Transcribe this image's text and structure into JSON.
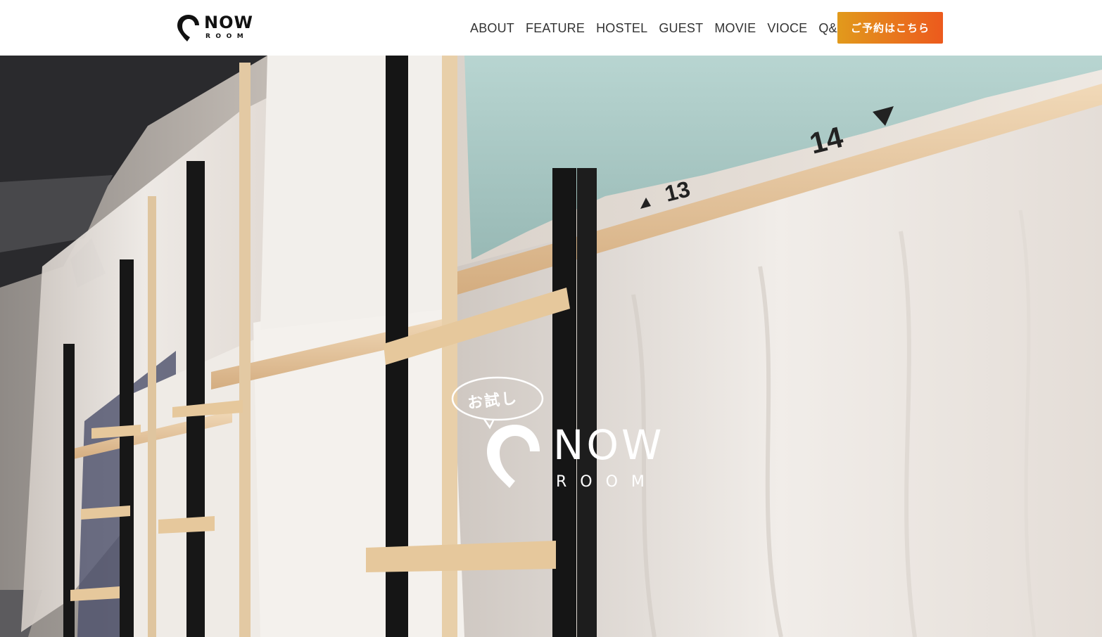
{
  "header": {
    "logo": {
      "word": "NOW",
      "sub": "ROOM"
    },
    "nav": [
      {
        "label": "ABOUT"
      },
      {
        "label": "FEATURE"
      },
      {
        "label": "HOSTEL"
      },
      {
        "label": "GUEST"
      },
      {
        "label": "MOVIE"
      },
      {
        "label": "VIOCE"
      },
      {
        "label": "Q&A"
      }
    ],
    "cta_label": "ご予約はこちら"
  },
  "hero": {
    "badge": "お試し",
    "logo_word": "NOW",
    "logo_sub": "ROOM",
    "bunk_numbers": [
      "13",
      "14"
    ]
  },
  "colors": {
    "cta_start": "#e19a1c",
    "cta_end": "#ec5a1d",
    "logo_dark": "#111111",
    "curtain_blue": "#a7c7c3"
  }
}
